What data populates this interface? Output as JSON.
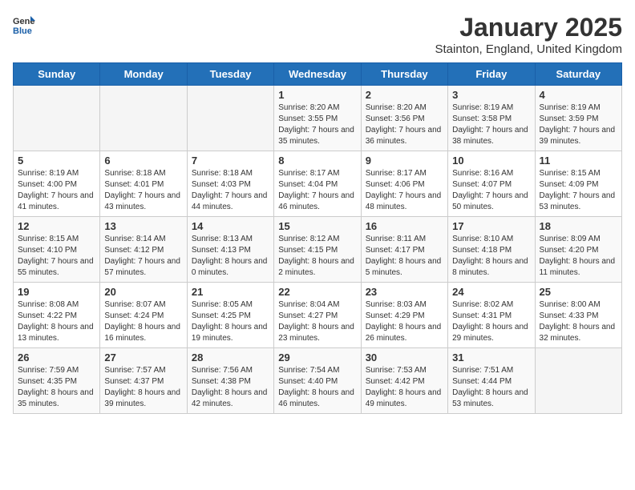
{
  "header": {
    "logo_general": "General",
    "logo_blue": "Blue",
    "title": "January 2025",
    "subtitle": "Stainton, England, United Kingdom"
  },
  "weekdays": [
    "Sunday",
    "Monday",
    "Tuesday",
    "Wednesday",
    "Thursday",
    "Friday",
    "Saturday"
  ],
  "weeks": [
    [
      {
        "day": "",
        "content": ""
      },
      {
        "day": "",
        "content": ""
      },
      {
        "day": "",
        "content": ""
      },
      {
        "day": "1",
        "content": "Sunrise: 8:20 AM\nSunset: 3:55 PM\nDaylight: 7 hours and 35 minutes."
      },
      {
        "day": "2",
        "content": "Sunrise: 8:20 AM\nSunset: 3:56 PM\nDaylight: 7 hours and 36 minutes."
      },
      {
        "day": "3",
        "content": "Sunrise: 8:19 AM\nSunset: 3:58 PM\nDaylight: 7 hours and 38 minutes."
      },
      {
        "day": "4",
        "content": "Sunrise: 8:19 AM\nSunset: 3:59 PM\nDaylight: 7 hours and 39 minutes."
      }
    ],
    [
      {
        "day": "5",
        "content": "Sunrise: 8:19 AM\nSunset: 4:00 PM\nDaylight: 7 hours and 41 minutes."
      },
      {
        "day": "6",
        "content": "Sunrise: 8:18 AM\nSunset: 4:01 PM\nDaylight: 7 hours and 43 minutes."
      },
      {
        "day": "7",
        "content": "Sunrise: 8:18 AM\nSunset: 4:03 PM\nDaylight: 7 hours and 44 minutes."
      },
      {
        "day": "8",
        "content": "Sunrise: 8:17 AM\nSunset: 4:04 PM\nDaylight: 7 hours and 46 minutes."
      },
      {
        "day": "9",
        "content": "Sunrise: 8:17 AM\nSunset: 4:06 PM\nDaylight: 7 hours and 48 minutes."
      },
      {
        "day": "10",
        "content": "Sunrise: 8:16 AM\nSunset: 4:07 PM\nDaylight: 7 hours and 50 minutes."
      },
      {
        "day": "11",
        "content": "Sunrise: 8:15 AM\nSunset: 4:09 PM\nDaylight: 7 hours and 53 minutes."
      }
    ],
    [
      {
        "day": "12",
        "content": "Sunrise: 8:15 AM\nSunset: 4:10 PM\nDaylight: 7 hours and 55 minutes."
      },
      {
        "day": "13",
        "content": "Sunrise: 8:14 AM\nSunset: 4:12 PM\nDaylight: 7 hours and 57 minutes."
      },
      {
        "day": "14",
        "content": "Sunrise: 8:13 AM\nSunset: 4:13 PM\nDaylight: 8 hours and 0 minutes."
      },
      {
        "day": "15",
        "content": "Sunrise: 8:12 AM\nSunset: 4:15 PM\nDaylight: 8 hours and 2 minutes."
      },
      {
        "day": "16",
        "content": "Sunrise: 8:11 AM\nSunset: 4:17 PM\nDaylight: 8 hours and 5 minutes."
      },
      {
        "day": "17",
        "content": "Sunrise: 8:10 AM\nSunset: 4:18 PM\nDaylight: 8 hours and 8 minutes."
      },
      {
        "day": "18",
        "content": "Sunrise: 8:09 AM\nSunset: 4:20 PM\nDaylight: 8 hours and 11 minutes."
      }
    ],
    [
      {
        "day": "19",
        "content": "Sunrise: 8:08 AM\nSunset: 4:22 PM\nDaylight: 8 hours and 13 minutes."
      },
      {
        "day": "20",
        "content": "Sunrise: 8:07 AM\nSunset: 4:24 PM\nDaylight: 8 hours and 16 minutes."
      },
      {
        "day": "21",
        "content": "Sunrise: 8:05 AM\nSunset: 4:25 PM\nDaylight: 8 hours and 19 minutes."
      },
      {
        "day": "22",
        "content": "Sunrise: 8:04 AM\nSunset: 4:27 PM\nDaylight: 8 hours and 23 minutes."
      },
      {
        "day": "23",
        "content": "Sunrise: 8:03 AM\nSunset: 4:29 PM\nDaylight: 8 hours and 26 minutes."
      },
      {
        "day": "24",
        "content": "Sunrise: 8:02 AM\nSunset: 4:31 PM\nDaylight: 8 hours and 29 minutes."
      },
      {
        "day": "25",
        "content": "Sunrise: 8:00 AM\nSunset: 4:33 PM\nDaylight: 8 hours and 32 minutes."
      }
    ],
    [
      {
        "day": "26",
        "content": "Sunrise: 7:59 AM\nSunset: 4:35 PM\nDaylight: 8 hours and 35 minutes."
      },
      {
        "day": "27",
        "content": "Sunrise: 7:57 AM\nSunset: 4:37 PM\nDaylight: 8 hours and 39 minutes."
      },
      {
        "day": "28",
        "content": "Sunrise: 7:56 AM\nSunset: 4:38 PM\nDaylight: 8 hours and 42 minutes."
      },
      {
        "day": "29",
        "content": "Sunrise: 7:54 AM\nSunset: 4:40 PM\nDaylight: 8 hours and 46 minutes."
      },
      {
        "day": "30",
        "content": "Sunrise: 7:53 AM\nSunset: 4:42 PM\nDaylight: 8 hours and 49 minutes."
      },
      {
        "day": "31",
        "content": "Sunrise: 7:51 AM\nSunset: 4:44 PM\nDaylight: 8 hours and 53 minutes."
      },
      {
        "day": "",
        "content": ""
      }
    ]
  ]
}
